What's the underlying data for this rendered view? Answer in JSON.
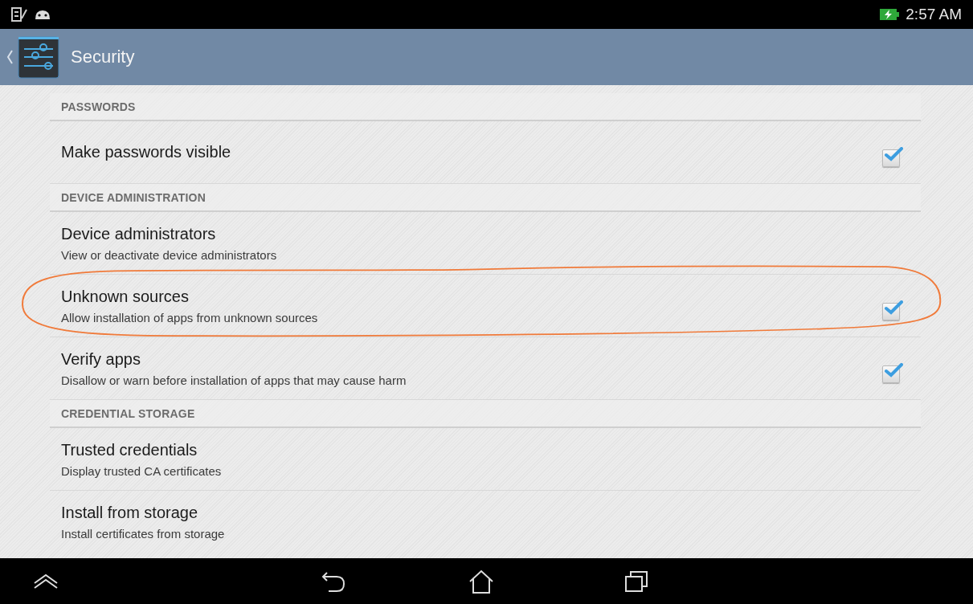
{
  "status_bar": {
    "time": "2:57 AM"
  },
  "action_bar": {
    "title": "Security"
  },
  "items": [
    {
      "kind": "header",
      "title": "PASSWORDS"
    },
    {
      "kind": "setting",
      "title": "Make passwords visible",
      "checked": true
    },
    {
      "kind": "header",
      "title": "DEVICE ADMINISTRATION"
    },
    {
      "kind": "setting",
      "title": "Device administrators",
      "subtitle": "View or deactivate device administrators"
    },
    {
      "kind": "setting",
      "title": "Unknown sources",
      "subtitle": "Allow installation of apps from unknown sources",
      "checked": true
    },
    {
      "kind": "setting",
      "title": "Verify apps",
      "subtitle": "Disallow or warn before installation of apps that may cause harm",
      "checked": true
    },
    {
      "kind": "header",
      "title": "CREDENTIAL STORAGE"
    },
    {
      "kind": "setting",
      "title": "Trusted credentials",
      "subtitle": "Display trusted CA certificates"
    },
    {
      "kind": "setting",
      "title": "Install from storage",
      "subtitle": "Install certificates from storage"
    }
  ]
}
